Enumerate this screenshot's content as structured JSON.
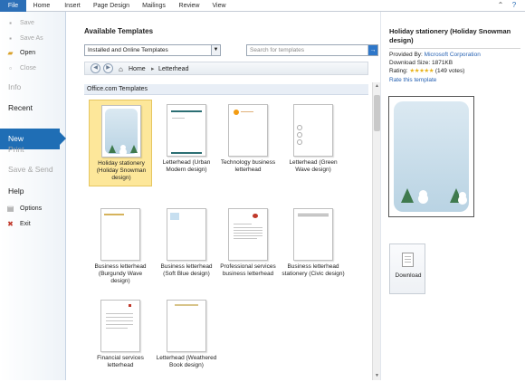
{
  "ribbon": {
    "tabs": [
      "File",
      "Home",
      "Insert",
      "Page Design",
      "Mailings",
      "Review",
      "View"
    ]
  },
  "sidebar": {
    "save": "Save",
    "save_as": "Save As",
    "open": "Open",
    "close": "Close",
    "info": "Info",
    "recent": "Recent",
    "new": "New",
    "print": "Print",
    "save_send": "Save & Send",
    "help": "Help",
    "options": "Options",
    "exit": "Exit"
  },
  "main": {
    "title": "Available Templates",
    "filter_value": "Installed and Online Templates",
    "search_placeholder": "Search for templates",
    "breadcrumb": {
      "home": "Home",
      "current": "Letterhead"
    },
    "section": "Office.com Templates",
    "templates": [
      {
        "label": "Holiday stationery (Holiday Snowman design)",
        "selected": true
      },
      {
        "label": "Letterhead (Urban Modern design)"
      },
      {
        "label": "Technology business letterhead"
      },
      {
        "label": "Letterhead (Green Wave design)"
      },
      {
        "label": "Business letterhead (Burgundy Wave design)"
      },
      {
        "label": "Business letterhead (Soft Blue design)"
      },
      {
        "label": "Professional services business letterhead"
      },
      {
        "label": "Business letterhead stationery (Civic design)"
      },
      {
        "label": "Financial services letterhead"
      },
      {
        "label": "Letterhead (Weathered Book design)"
      }
    ]
  },
  "pane": {
    "title": "Holiday stationery (Holiday Snowman design)",
    "provided_by_label": "Provided By:",
    "provided_by": "Microsoft Corporation",
    "download_size": "Download Size: 1871KB",
    "rating_label": "Rating:",
    "rating_stars": 5,
    "rating_votes": "(149 votes)",
    "rate_link": "Rate this template",
    "download_button": "Download"
  },
  "colors": {
    "file_tab": "#2c6fb7",
    "new_highlight": "#1f6eb5",
    "selected_tile": "#fde79a",
    "link": "#2762b3"
  }
}
